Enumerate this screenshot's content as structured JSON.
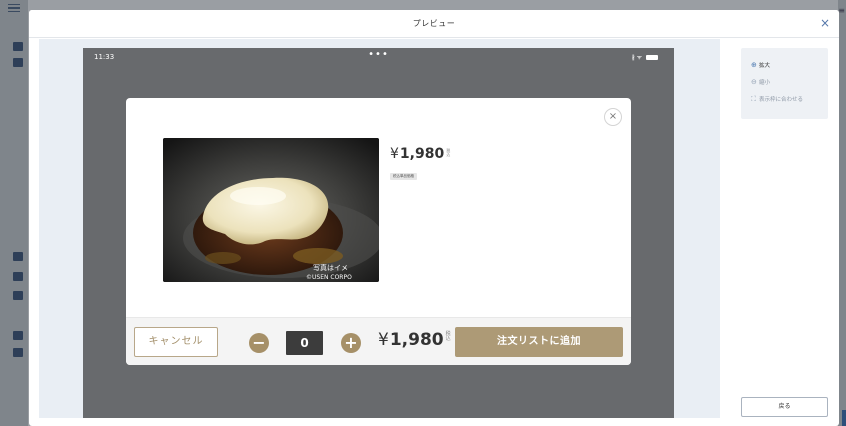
{
  "window": {
    "title": "プレビュー",
    "close_label": "×"
  },
  "device": {
    "status_time": "11:33",
    "status_dots": "•••",
    "status_icons": "∦ ᯤ"
  },
  "item_modal": {
    "close_label": "×",
    "photo_caption_line1": "写真はイメ",
    "photo_caption_line2": "©USEN CORPO",
    "price_yen": "¥",
    "price": "1,980",
    "tax_label": "税込",
    "tag": "税込単品価格",
    "footer": {
      "cancel_label": "キャンセル",
      "minus_label": "−",
      "quantity": "0",
      "plus_label": "+",
      "price_yen": "¥",
      "price": "1,980",
      "tax_label": "税込",
      "add_label": "注文リストに追加"
    }
  },
  "side_panel": {
    "items": [
      {
        "icon": "⊕",
        "label": "拡大",
        "enabled": true
      },
      {
        "icon": "⊖",
        "label": "縮小",
        "enabled": false
      },
      {
        "icon": "⛶",
        "label": "表示枠に合わせる",
        "enabled": false
      }
    ],
    "back_label": "戻る"
  },
  "colors": {
    "accent_gold": "#ad9a76",
    "cancel_border": "#b8a789",
    "link_blue": "#4a78b0"
  }
}
